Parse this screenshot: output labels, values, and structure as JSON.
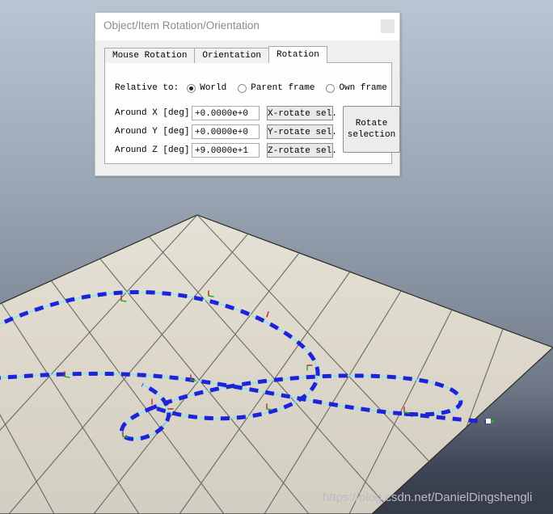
{
  "scene": {
    "description": "3D simulation viewport with tiled floor plane and dashed blue path",
    "sky_top_color": "#b9c5d2",
    "sky_bottom_color": "#393e4b",
    "floor_color": "#ded9cd",
    "grid_line_color": "#5b5b57",
    "path_color": "#1f23d8",
    "path_guide_color": "#7fe8f5",
    "path_marker_red": "#d02020",
    "path_marker_green": "#20b020",
    "endpoint_color": "#ffffff"
  },
  "dialog": {
    "title": "Object/Item Rotation/Orientation",
    "close_label": "×",
    "tabs": [
      {
        "label": "Mouse Rotation",
        "active": false
      },
      {
        "label": "Orientation",
        "active": false
      },
      {
        "label": "Rotation",
        "active": true
      }
    ],
    "relative": {
      "label": "Relative to:",
      "options": [
        {
          "label": "World",
          "selected": true
        },
        {
          "label": "Parent frame",
          "selected": false
        },
        {
          "label": "Own frame",
          "selected": false
        }
      ]
    },
    "axis_rows": [
      {
        "label": "Around X [deg]",
        "value": "+0.0000e+0",
        "button": "X-rotate sel."
      },
      {
        "label": "Around Y [deg]",
        "value": "+0.0000e+0",
        "button": "Y-rotate sel."
      },
      {
        "label": "Around Z [deg]",
        "value": "+9.0000e+1",
        "button": "Z-rotate sel."
      }
    ],
    "rotate_button": {
      "line1": "Rotate",
      "line2": "selection"
    }
  },
  "watermark": {
    "text": "https://blog.csdn.net/DanielDingshengli"
  }
}
